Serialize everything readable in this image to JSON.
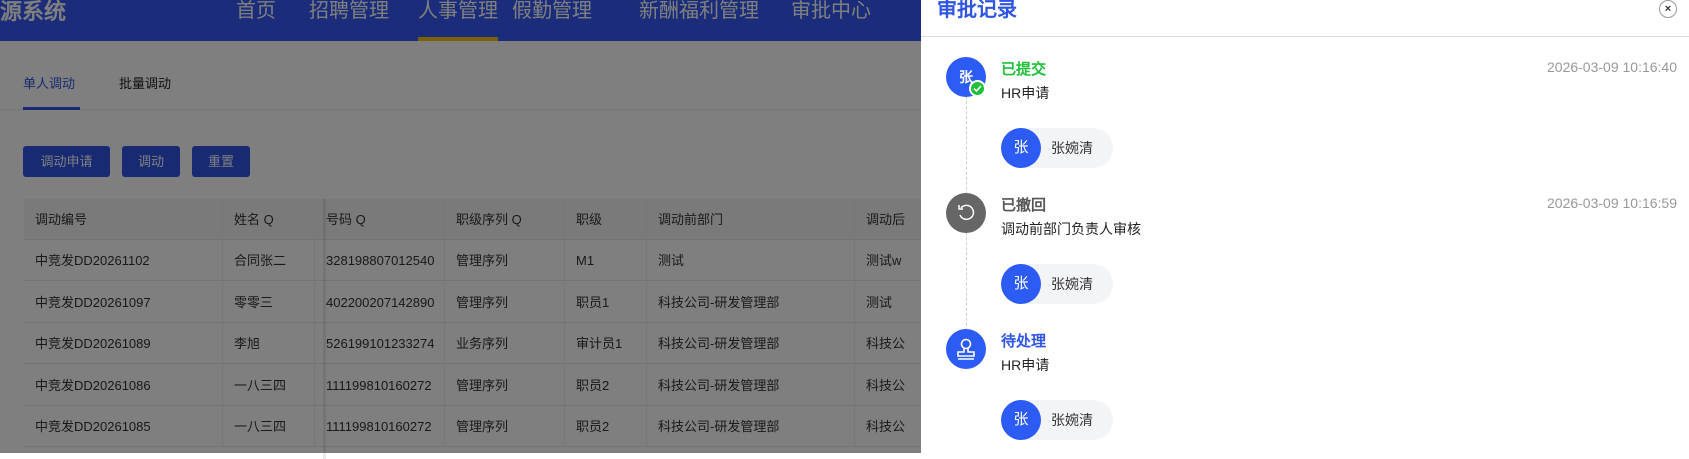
{
  "header": {
    "logo": "源系统",
    "nav": [
      "首页",
      "招聘管理",
      "人事管理",
      "假勤管理",
      "新酬福利管理",
      "审批中心"
    ],
    "active_nav": "人事管理"
  },
  "tabs": [
    "单人调动",
    "批量调动"
  ],
  "buttons": {
    "apply": "调动申请",
    "transfer": "调动",
    "reset": "重置"
  },
  "table": {
    "columns": [
      "调动编号",
      "姓名 Q",
      "号码 Q",
      "职级序列 Q",
      "职级",
      "调动前部门",
      "调动后"
    ],
    "rows": [
      [
        "中竞发DD20261102",
        "合同张二",
        "328198807012540",
        "管理序列",
        "M1",
        "测试",
        "测试w"
      ],
      [
        "中竞发DD20261097",
        "零零三",
        "402200207142890",
        "管理序列",
        "职员1",
        "科技公司-研发管理部",
        "测试"
      ],
      [
        "中竞发DD20261089",
        "李旭",
        "526199101233274",
        "业务序列",
        "审计员1",
        "科技公司-研发管理部",
        "科技公"
      ],
      [
        "中竞发DD20261086",
        "一八三四",
        "111199810160272",
        "管理序列",
        "职员2",
        "科技公司-研发管理部",
        "科技公"
      ],
      [
        "中竞发DD20261085",
        "一八三四",
        "111199810160272",
        "管理序列",
        "职员2",
        "科技公司-研发管理部",
        "科技公"
      ]
    ]
  },
  "drawer": {
    "title": "审批记录",
    "close": "×",
    "records": [
      {
        "avatar": "张",
        "status": "已提交",
        "status_color": "#1fbf3a",
        "step": "HR申请",
        "time": "2026-03-09 10:16:40",
        "person_avatar": "张",
        "person": "张婉清"
      },
      {
        "avatar": "⟲",
        "status": "已撤回",
        "status_color": "#555555",
        "step": "调动前部门负责人审核",
        "time": "2026-03-09 10:16:59",
        "person_avatar": "张",
        "person": "张婉清"
      },
      {
        "avatar": "stamp",
        "status": "待处理",
        "status_color": "#2f55e4",
        "step": "HR申请",
        "time": "",
        "person_avatar": "张",
        "person": "张婉清"
      }
    ]
  }
}
